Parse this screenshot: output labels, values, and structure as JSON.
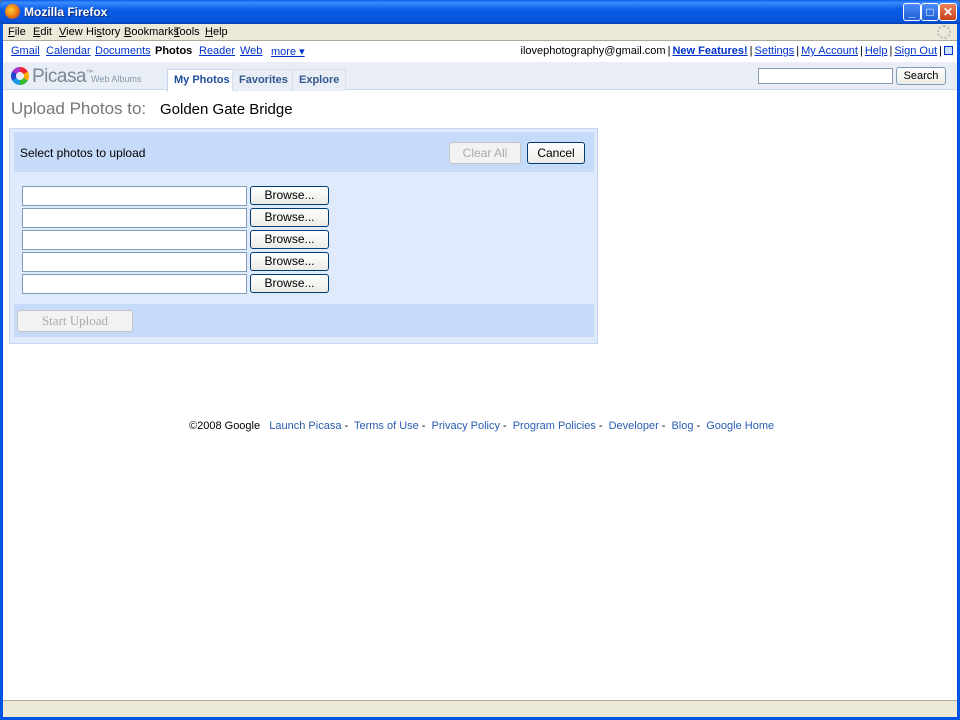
{
  "window": {
    "title": "Mozilla Firefox",
    "min_glyph": "_",
    "max_glyph": "□",
    "close_glyph": "✕"
  },
  "menubar": {
    "items": [
      "File",
      "Edit",
      "View",
      "History",
      "Bookmarks",
      "Tools",
      "Help"
    ],
    "mnemonics": [
      "F",
      "E",
      "V",
      "s",
      "B",
      "T",
      "H"
    ]
  },
  "gbar": {
    "links": [
      "Gmail",
      "Calendar",
      "Documents",
      "Photos",
      "Reader",
      "Web",
      "more ▾"
    ],
    "current": "Photos",
    "email": "ilovephotography@gmail.com",
    "new_features": "New Features!",
    "settings": "Settings",
    "my_account": "My Account",
    "help": "Help",
    "sign_out": "Sign Out"
  },
  "picasa": {
    "logo_text": "Picasa",
    "logo_tm": "™",
    "logo_sub": "Web Albums",
    "tabs": [
      "My Photos",
      "Favorites",
      "Explore"
    ],
    "active_tab": "My Photos",
    "search_value": "",
    "search_button": "Search"
  },
  "upload": {
    "heading": "Upload Photos to:",
    "album": "Golden Gate Bridge",
    "select_text": "Select photos to upload",
    "clear_all": "Clear All",
    "cancel": "Cancel",
    "browse_label": "Browse...",
    "file_values": [
      "",
      "",
      "",
      "",
      ""
    ],
    "start_upload": "Start Upload"
  },
  "footer": {
    "copyright": "©2008 Google",
    "links": [
      "Launch Picasa",
      "Terms of Use",
      "Privacy Policy",
      "Program Policies",
      "Developer",
      "Blog",
      "Google Home"
    ]
  },
  "colors": {
    "link": "#0033cc",
    "panel_bg": "#dfeafd",
    "panel_strip": "#c6dbfa",
    "xp_titlebar": "#0a5ce6"
  }
}
